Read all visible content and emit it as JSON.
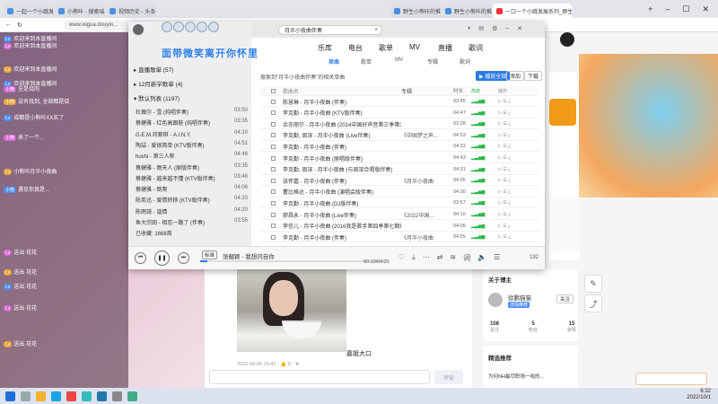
{
  "browser": {
    "tabs": [
      {
        "label": "一起一个小跳发展系列_野生小..."
      },
      {
        "label": "小熊咔 - 搜索结果_头条搜索"
      },
      {
        "label": "视频历史 - 头条"
      },
      {
        "label": "野生小熊咔的推荐_头条搜索"
      },
      {
        "label": "野生小熊咔的推荐_头条搜索"
      },
      {
        "label": "一口一个小跳发展系列_野生小熊咔"
      }
    ],
    "url": "www.ixigua.douyin..."
  },
  "chat": {
    "messages": [
      {
        "badge": "",
        "user": "",
        "text": "欢迎来到本直播间"
      },
      {
        "badge": "",
        "user": "",
        "text": "欢迎来到本直播间"
      },
      {
        "badge": "",
        "user": "",
        "text": "欢迎来到本直播间"
      },
      {
        "badge": "",
        "user": "",
        "text": "欢迎来到本直播间"
      },
      {
        "badge": "小熊",
        "user": "",
        "text": "全是烧肉"
      },
      {
        "badge": "小熊",
        "user": "",
        "text": "没有找到, 全部都是烧"
      },
      {
        "badge": "",
        "user": "",
        "text": "成都是小熊咔XX买了"
      },
      {
        "badge": "小熊",
        "user": "",
        "text": "来了一个..."
      },
      {
        "badge": "",
        "user": "",
        "text": "小熊咔月半小夜曲"
      },
      {
        "badge": "小熊",
        "user": "",
        "text": "遇见你真是..."
      },
      {
        "badge": "",
        "user": "",
        "text": "送出 花花"
      },
      {
        "badge": "",
        "user": "",
        "text": "送出 花花"
      },
      {
        "badge": "",
        "user": "",
        "text": "送出 花花"
      },
      {
        "badge": "",
        "user": "",
        "text": "送出 花花"
      },
      {
        "badge": "",
        "user": "",
        "text": "送出 花花"
      }
    ]
  },
  "player": {
    "search_query": "月半小夜曲伴奏",
    "nav": [
      "乐库",
      "电台",
      "歌单",
      "MV",
      "直播",
      "歌词"
    ],
    "subnav": [
      "单曲",
      "歌单",
      "MV",
      "专辑",
      "歌词"
    ],
    "result_text": "搜索到\"月半小夜曲伴奏\"的相关单曲",
    "play_all": "播放全部",
    "add_btn": "添加",
    "download_btn": "下载",
    "col_headers": [
      "歌曲名",
      "专辑",
      "时长",
      "热度",
      "操作"
    ],
    "overlay_text": "面带微笑离开你怀里",
    "groups": [
      {
        "label": "直播歌单 (57)"
      },
      {
        "label": "12月新学歌单 (4)"
      },
      {
        "label": "默认列表 (1197)"
      }
    ],
    "left_list": [
      {
        "title": "杜薇尔 - 雪 (纯唱伴奏)",
        "time": "03:50"
      },
      {
        "title": "蔡健雅 - 红色高跟鞋 (纯唱伴奏)",
        "time": "03:35"
      },
      {
        "title": "G.E.M.邓紫棋 - A.I.N.Y.",
        "time": "04:20"
      },
      {
        "title": "陶喆 - 爱很简单 (KTV版伴奏)",
        "time": "04:51"
      },
      {
        "title": "hushi - 第三人称",
        "time": "04:46"
      },
      {
        "title": "蔡健雅 - 雨天人 (原版伴奏)",
        "time": "03:35"
      },
      {
        "title": "蔡健雅 - 越来越不懂 (KTV版伴奏)",
        "time": "03:46"
      },
      {
        "title": "蔡健雅 - 倒爬",
        "time": "04:06"
      },
      {
        "title": "陈奕迅 - 爱情转移 (KTV版伴奏)",
        "time": "04:20"
      },
      {
        "title": "陈雨琦 - 谐情",
        "time": "04:20"
      },
      {
        "title": "鱼大宗田 - 相恋一路了 (伴奏)",
        "time": "03:55"
      },
      {
        "title": "已收藏: 1668首",
        "time": ""
      }
    ],
    "songs": [
      {
        "title": "陈慧琳 - 月半小夜曲 (伴奏)",
        "album": "",
        "dur": "03:45"
      },
      {
        "title": "李克勤 - 月半小夜曲 (KTV版伴奏)",
        "album": "",
        "dur": "04:47"
      },
      {
        "title": "余亦丽尔 - 月半小夜曲 (2014中国好声音第三季第3期现场伴奏)",
        "album": "",
        "dur": "03:28"
      },
      {
        "title": "李克勤, 周深 - 月半小夜曲 (Live伴奏)",
        "album": "《中国梦之声...",
        "dur": "04:53"
      },
      {
        "title": "李克勤 - 月半小夜曲 (伴奏)",
        "album": "",
        "dur": "04:33"
      },
      {
        "title": "李克勤 - 月半小夜曲 (原唱版伴奏)",
        "album": "",
        "dur": "04:43"
      },
      {
        "title": "李克勤, 周深 - 月半小夜曲 (与周深合唱版伴奏)",
        "album": "",
        "dur": "04:31"
      },
      {
        "title": "张怀嘉 - 月半小夜曲 (伴奏)",
        "album": "《月半小夜曲",
        "dur": "04:05"
      },
      {
        "title": "曹比格达 - 月半小夜曲 (演唱会版伴奏)",
        "album": "",
        "dur": "04:30"
      },
      {
        "title": "李克勤 - 月半小夜曲 (DJ版伴奏)",
        "album": "",
        "dur": "03:57"
      },
      {
        "title": "廖昌永 - 月半小夜曲 (Live伴奏)",
        "album": "《2022中国...",
        "dur": "04:10"
      },
      {
        "title": "李信儿 - 月半小夜曲 (2016我是歌手第四季第七期现场伴奏)",
        "album": "",
        "dur": "04:05"
      },
      {
        "title": "李克勤 - 月半小夜曲 (伴奏)",
        "album": "《月半小夜曲",
        "dur": "04:55"
      }
    ],
    "now_playing": "张靓颖 - 我想问自你",
    "time_display": "00:10/04:21",
    "mode_tag": "标准",
    "count": "192"
  },
  "post": {
    "date_line": "2022-08-05 15:42 · 👍 0 · ★",
    "caption": "嘉姐大口",
    "comment_placeholder": "",
    "send_label": "评论"
  },
  "profile": {
    "name": "徐鹏猫猫",
    "tag": "详情推荐",
    "follow": "关注",
    "stats": [
      {
        "value": "108",
        "label": "关注"
      },
      {
        "value": "5",
        "label": "粉丝"
      },
      {
        "value": "15",
        "label": "获赞"
      }
    ],
    "section_title": "关于博主",
    "hot_title": "精选推荐",
    "hot_item": "为何NH最尽职场一哈的..."
  },
  "taskbar": {
    "time": "6:32",
    "date": "2022/10/1"
  }
}
